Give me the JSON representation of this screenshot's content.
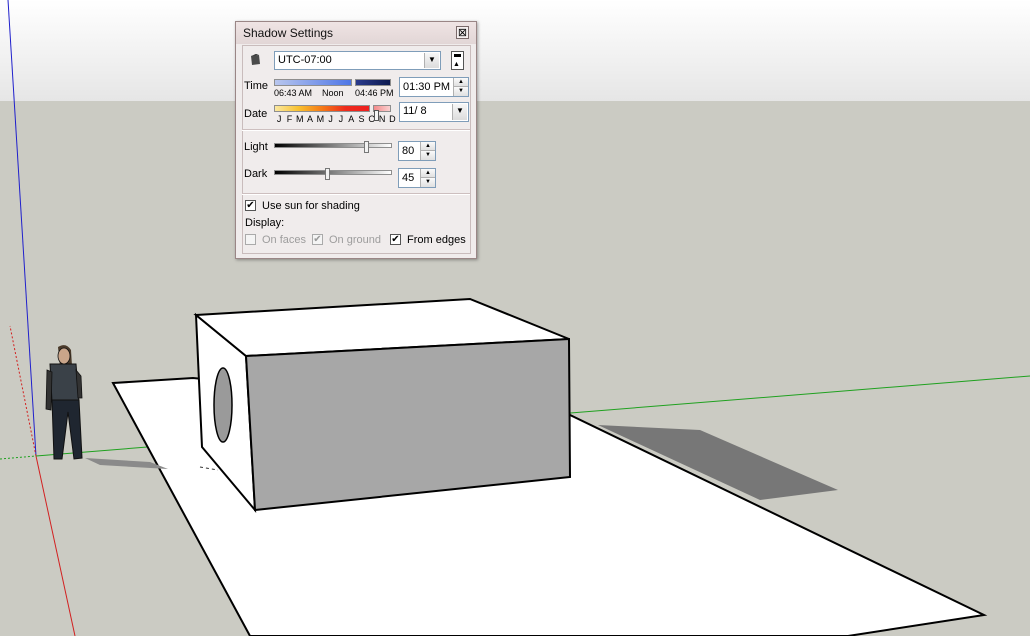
{
  "dialog": {
    "title": "Shadow Settings",
    "close_glyph": "⊠",
    "timezone": "UTC-07:00",
    "time_label": "Time",
    "sunrise": "06:43 AM",
    "noon": "Noon",
    "sunset": "04:46 PM",
    "time_value": "01:30 PM",
    "date_label": "Date",
    "months": [
      "J",
      "F",
      "M",
      "A",
      "M",
      "J",
      "J",
      "A",
      "S",
      "O",
      "N",
      "D"
    ],
    "date_value": "11/ 8",
    "light_label": "Light",
    "light_value": "80",
    "light_level_pct": 80,
    "dark_label": "Dark",
    "dark_value": "45",
    "dark_level_pct": 45,
    "time_level_pct": 77,
    "date_level_pct": 85,
    "use_sun_label": "Use sun for shading",
    "use_sun_checked": true,
    "display_label": "Display:",
    "on_faces_label": "On faces",
    "on_faces_checked": false,
    "on_ground_label": "On ground",
    "on_ground_checked": true,
    "from_edges_label": "From edges",
    "from_edges_checked": true
  },
  "colors": {
    "sky": "#e9e9e9",
    "ground": "#cbcbc3",
    "face_light": "#ffffff",
    "face_shaded": "#a7a7a7",
    "shadow": "#777777",
    "axis_red": "#d22020",
    "axis_green": "#1fa11f",
    "axis_blue": "#2020cc"
  }
}
